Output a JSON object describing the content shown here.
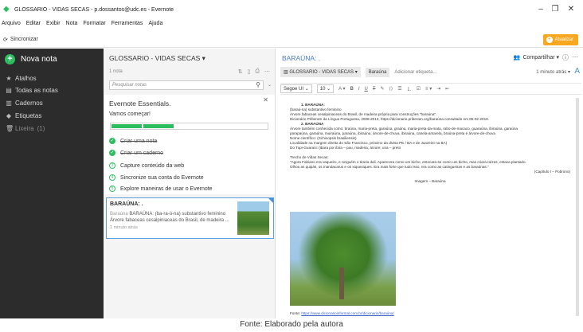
{
  "window": {
    "title": "GLOSSARIO - VIDAS SECAS - p.dossantos@udc.es - Evernote",
    "controls": {
      "minimize": "–",
      "maximize": "❐",
      "close": "✕"
    }
  },
  "menu": [
    "Arquivo",
    "Editar",
    "Exibir",
    "Nota",
    "Formatar",
    "Ferramentas",
    "Ajuda"
  ],
  "toolbar": {
    "sync_label": "Sincronizar",
    "upgrade_label": "Atualizar",
    "upgrade_color": "#f7a820"
  },
  "sidebar": {
    "bg_color": "#2c2c2c",
    "new_note": "Nova nota",
    "items": [
      {
        "icon": "star-icon",
        "label": "Atalhos"
      },
      {
        "icon": "notes-icon",
        "label": "Todas as notas"
      },
      {
        "icon": "notebook-icon",
        "label": "Cadernos"
      },
      {
        "icon": "tag-icon",
        "label": "Etiquetas"
      },
      {
        "icon": "trash-icon",
        "label": "Lixeira",
        "count": "(1)"
      }
    ]
  },
  "notelist": {
    "title": "GLOSSARIO - VIDAS SECAS ▾",
    "count": "1 nota",
    "search_placeholder": "Pesquisar notas",
    "essentials": {
      "title": "Evernote Essentials.",
      "subtitle": "Vamos começar!",
      "progress": 0.4,
      "accent": "#2dbe60",
      "tasks": [
        {
          "label": "Criar uma nota",
          "done": true
        },
        {
          "label": "Criar um caderno",
          "done": true
        },
        {
          "label": "Capture conteúdo da web",
          "done": false,
          "num": "3"
        },
        {
          "label": "Sincronize sua conta do Evernote",
          "done": false,
          "num": "4"
        },
        {
          "label": "Explore maneiras de usar o Evernote",
          "done": false,
          "num": "5"
        }
      ]
    },
    "card": {
      "title": "BARAÚNA: .",
      "snippet_prefix": "Baraúna",
      "snippet": "BARAÚNA: (ba-ra-ú-na) substantivo feminino Árvore fabaceas cesalpiniaceas do Brasil, de madeira ...",
      "date": "1 minuto atrás"
    }
  },
  "editor": {
    "title": "BARAÚNA: .",
    "share": "Compartilhar ▾",
    "notebook": "GLOSSARIO - VIDAS SECAS ▾",
    "tag": "Baraúna",
    "add_tag": "Adicionar etiqueta...",
    "updated": "1 minuto atrás ▾",
    "font": "Segoe UI",
    "size": "10",
    "lines": [
      {
        "text": "1.  BARAÚNA:",
        "cls": "h"
      },
      {
        "text": "(baraú-na) substantivo feminino",
        "cls": ""
      },
      {
        "text": "Árvore fabaceas cesalpiniaceas do Brasil, de madeira própria para construções \"baraúna\".",
        "cls": ""
      },
      {
        "text": "Dicionário Priberam da Língua Portuguesa, 2008-2013, https://dicionario.priberam.org/baraúna consultado em 05-02-2019.",
        "cls": ""
      },
      {
        "text": "2.  BARAÚNA",
        "cls": "h"
      },
      {
        "text": "Árvore também conhecida como: braúna, maria-preta, garaúna, graúna, maria-preta-da-mata, rabo-de-macaco, guaraúna, ibiraúna, garaúna",
        "cls": ""
      },
      {
        "text": "parapaúna, garaúna, muiraúna, paraúna, ibiraúna, árvore-de-chuva, ibiraúna, canela-amarela, braúna-preta é árvore-de-chuva",
        "cls": ""
      },
      {
        "text": "Nome científico: (Schinopsis brasiliensis)",
        "cls": ""
      },
      {
        "text": "Localidade na margem direita do São Francisco, próximo da divisa PE / BA e de Juazeiro na BA)",
        "cls": ""
      },
      {
        "text": "Do Tupi-Guarani: (ibara por ibira – pau, madeira; árvore; una – preto",
        "cls": ""
      },
      {
        "text": "",
        "cls": ""
      },
      {
        "text": "Trecho de Vidas Secas:",
        "cls": ""
      },
      {
        "text": "\"Agora Fabiano era vaqueiro, e ninguém o tiraria dali. Aparecera como um bicho, entocara-se como um bicho, mas criara raízes, estava plantado.",
        "cls": ""
      },
      {
        "text": "Olhou as quipás, os mandacarus e os xiquexiques. Era mais forte que tudo isso, era como as catingueiras e as baraúnas.\"",
        "cls": ""
      },
      {
        "text": "(Capítulo I – Pobrono)",
        "cls": "right"
      },
      {
        "text": "",
        "cls": ""
      },
      {
        "text": "Imagem – Baraúna",
        "cls": "center"
      }
    ],
    "source_prefix": "Fonte:",
    "source_link": "https://www.dicionarioinformal.com.br/dicionario/baraúna/"
  },
  "caption": "Fonte: Elaborado pela autora"
}
